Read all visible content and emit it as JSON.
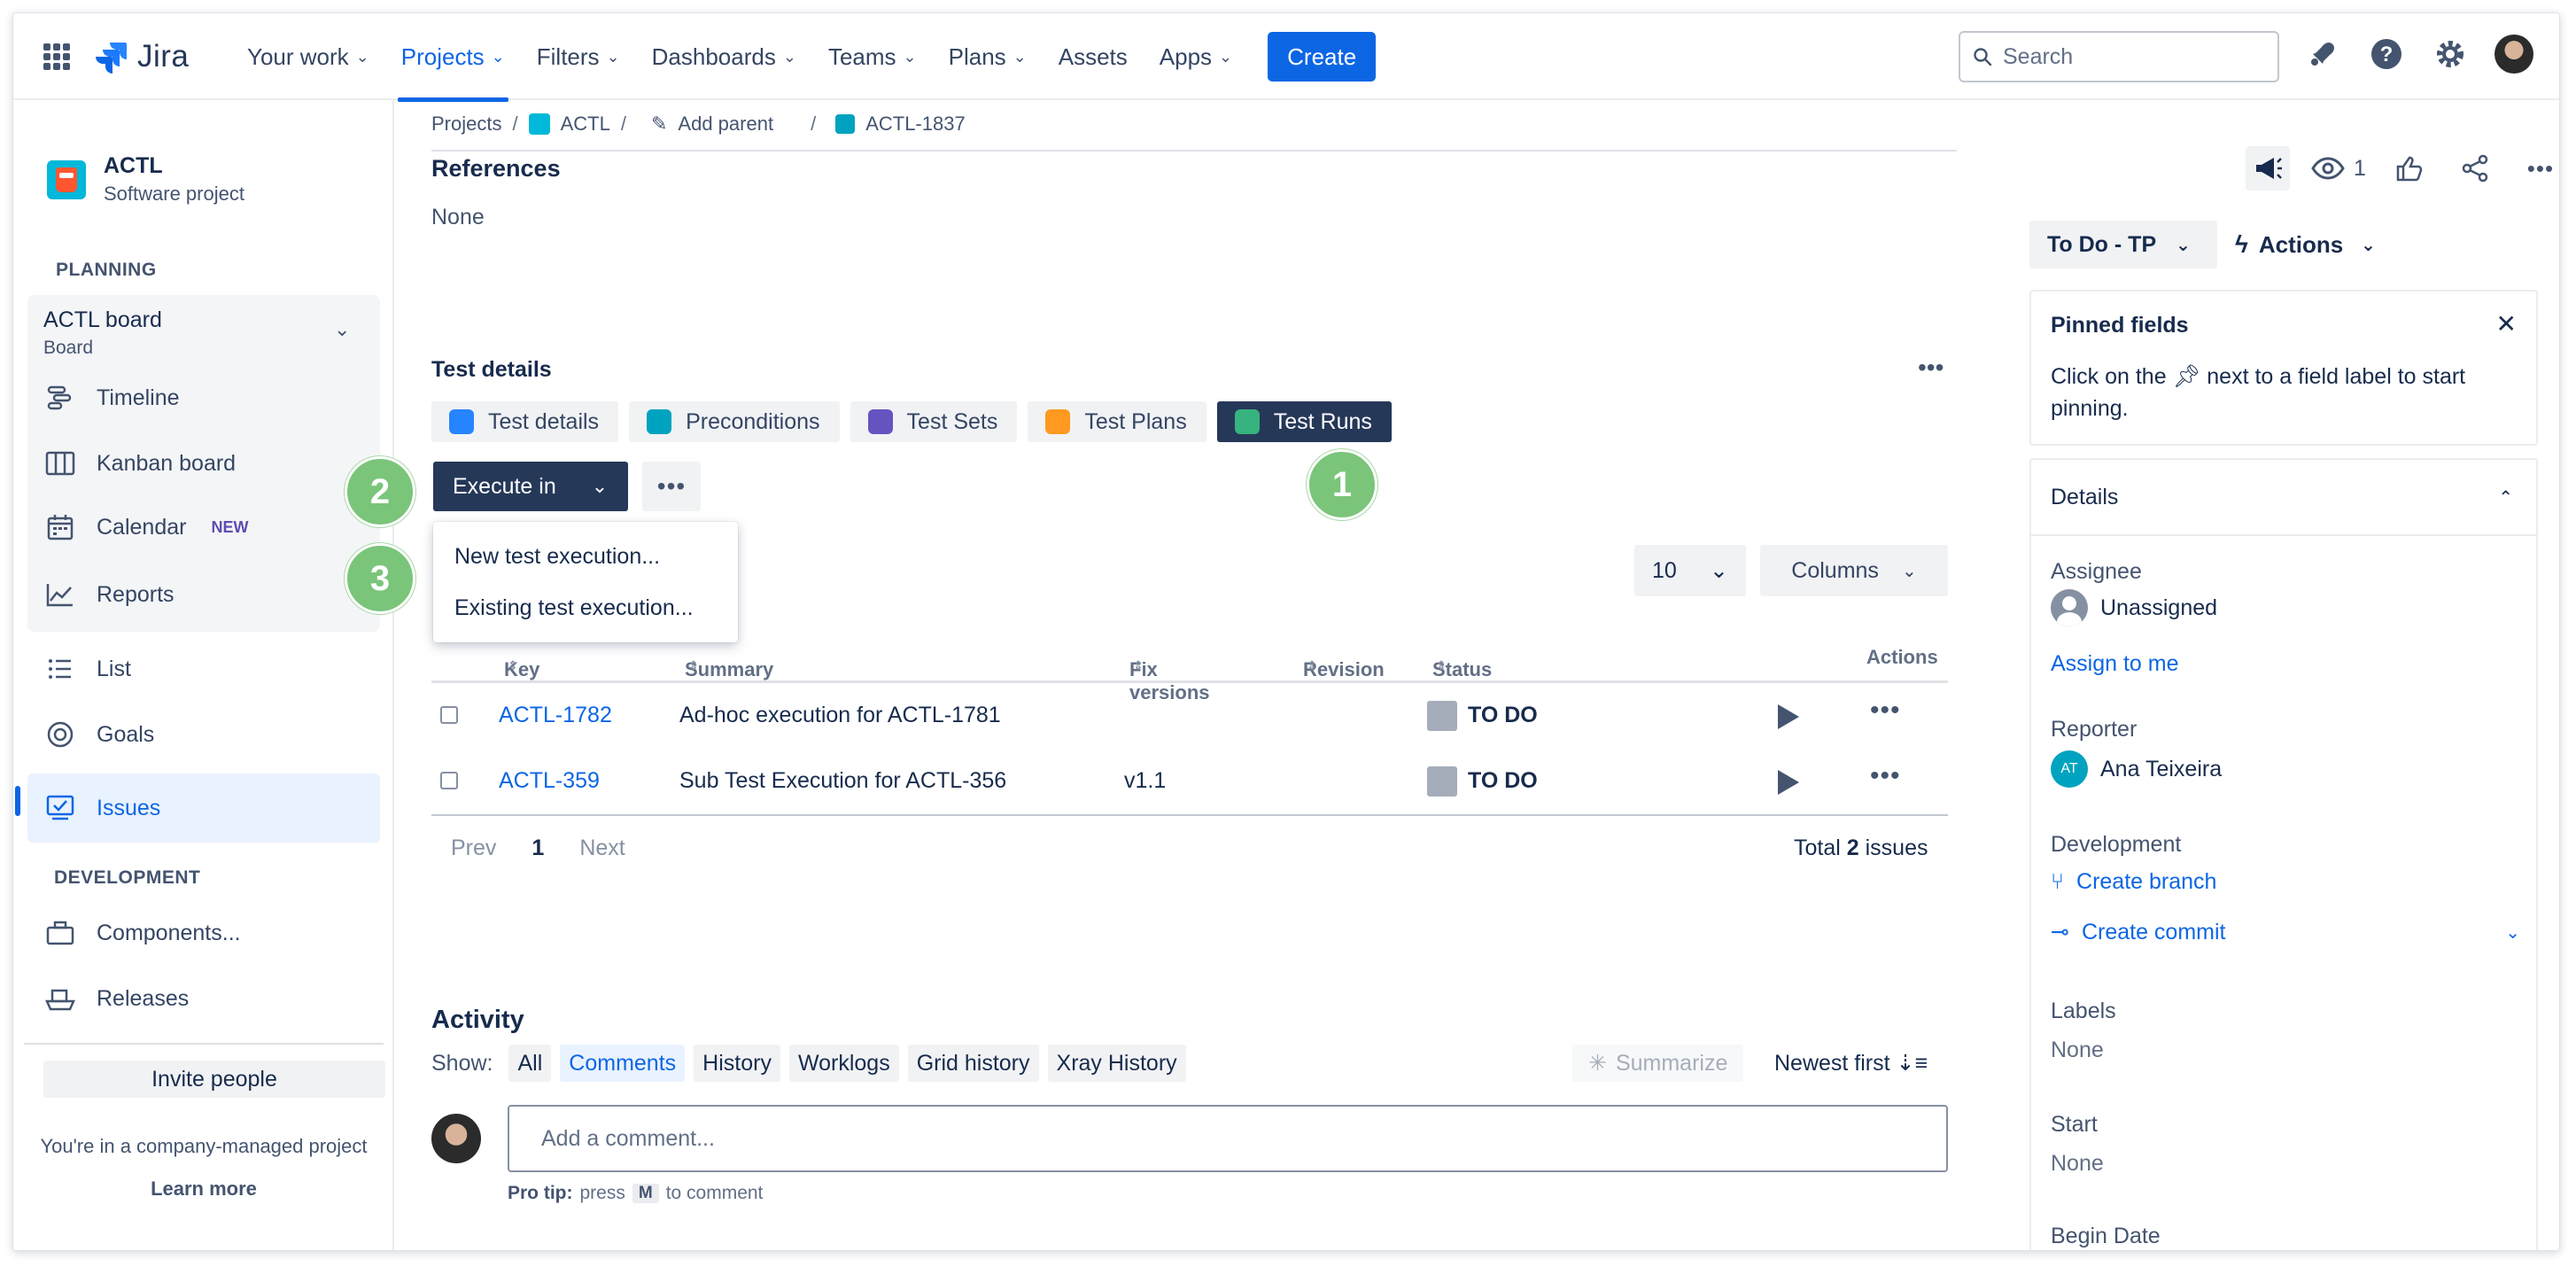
{
  "nav": {
    "logo": "Jira",
    "items": [
      {
        "label": "Your work"
      },
      {
        "label": "Projects"
      },
      {
        "label": "Filters"
      },
      {
        "label": "Dashboards"
      },
      {
        "label": "Teams"
      },
      {
        "label": "Plans"
      },
      {
        "label": "Assets"
      },
      {
        "label": "Apps"
      }
    ],
    "create": "Create",
    "search_placeholder": "Search"
  },
  "sidebar": {
    "project_name": "ACTL",
    "project_type": "Software project",
    "planning_label": "PLANNING",
    "board_title": "ACTL board",
    "board_sub": "Board",
    "items": [
      {
        "label": "Timeline"
      },
      {
        "label": "Kanban board"
      },
      {
        "label": "Calendar",
        "badge": "NEW"
      },
      {
        "label": "Reports"
      },
      {
        "label": "List"
      },
      {
        "label": "Goals"
      },
      {
        "label": "Issues"
      }
    ],
    "development_label": "DEVELOPMENT",
    "dev_items": [
      {
        "label": "Components..."
      },
      {
        "label": "Releases"
      }
    ],
    "invite": "Invite people",
    "company_note": "You're in a company-managed project",
    "learn_more": "Learn more"
  },
  "breadcrumb": {
    "projects": "Projects",
    "project": "ACTL",
    "add_parent": "Add parent",
    "issue": "ACTL-1837"
  },
  "references": {
    "title": "References",
    "value": "None"
  },
  "test_details": {
    "title": "Test details",
    "tabs": [
      {
        "label": "Test details",
        "color": "#2684ff"
      },
      {
        "label": "Preconditions",
        "color": "#00a3bf"
      },
      {
        "label": "Test Sets",
        "color": "#6554c0"
      },
      {
        "label": "Test Plans",
        "color": "#ff991f"
      },
      {
        "label": "Test Runs",
        "color": "#36b37e"
      }
    ],
    "execute_btn": "Execute in",
    "dropdown": [
      "New test execution...",
      "Existing test execution..."
    ],
    "page_size": "10",
    "columns_btn": "Columns",
    "headers": {
      "key": "Key",
      "summary": "Summary",
      "fix_versions": "Fix versions",
      "revision": "Revision",
      "status": "Status",
      "actions": "Actions"
    },
    "rows": [
      {
        "key": "ACTL-1782",
        "summary": "Ad-hoc execution for ACTL-1781",
        "fix_version": "",
        "status": "TO DO"
      },
      {
        "key": "ACTL-359",
        "summary": "Sub Test Execution for ACTL-356",
        "fix_version": "v1.1",
        "status": "TO DO"
      }
    ],
    "pager": {
      "prev": "Prev",
      "page": "1",
      "next": "Next"
    },
    "total_prefix": "Total",
    "total_count": "2",
    "total_suffix": "issues"
  },
  "badges": [
    "1",
    "2",
    "3"
  ],
  "activity": {
    "title": "Activity",
    "show_label": "Show:",
    "filters": [
      "All",
      "Comments",
      "History",
      "Worklogs",
      "Grid history",
      "Xray History"
    ],
    "summarize": "Summarize",
    "sort": "Newest first",
    "comment_placeholder": "Add a comment...",
    "protip_label": "Pro tip:",
    "protip_press": "press",
    "protip_key": "M",
    "protip_rest": "to comment"
  },
  "right_panel": {
    "watch_count": "1",
    "status": "To Do - TP",
    "actions": "Actions",
    "pinned_title": "Pinned fields",
    "pinned_text_a": "Click on the",
    "pinned_text_b": "next to a field label to start pinning.",
    "details_title": "Details",
    "assignee_label": "Assignee",
    "assignee_value": "Unassigned",
    "assign_to_me": "Assign to me",
    "reporter_label": "Reporter",
    "reporter_initials": "AT",
    "reporter_value": "Ana Teixeira",
    "development_label": "Development",
    "create_branch": "Create branch",
    "create_commit": "Create commit",
    "labels_label": "Labels",
    "labels_value": "None",
    "start_label": "Start",
    "start_value": "None",
    "begin_label": "Begin Date"
  }
}
